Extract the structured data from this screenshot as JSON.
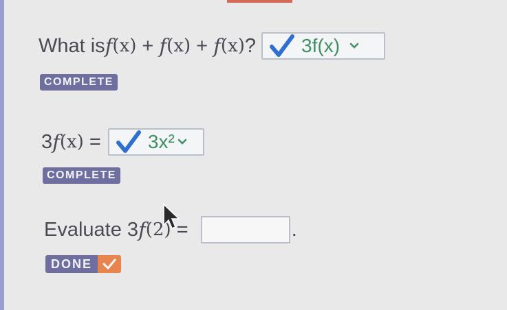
{
  "question1": {
    "prefix": "What is ",
    "f": "f",
    "arg": "(x)",
    "plus": " + ",
    "suffix": "?",
    "answer": "3f(x)"
  },
  "badge1": {
    "label": "COMPLETE"
  },
  "question2": {
    "coef": "3",
    "f": "f",
    "arg": "(x)",
    "equals": " = ",
    "answer": "3x²"
  },
  "badge2": {
    "label": "COMPLETE"
  },
  "question3": {
    "prefix": "Evaluate ",
    "coef": "3",
    "f": "f",
    "arg": "(2)",
    "equals": " = ",
    "input_value": "",
    "period": "."
  },
  "done_button": {
    "label": "DONE"
  },
  "colors": {
    "badge": "#6f6f9f",
    "correct": "#3f8f63",
    "check": "#2f6fd0",
    "done_accent": "#e8844e"
  },
  "icons": {
    "answer_check": "checkmark-icon",
    "dropdown": "chevron-down-icon",
    "done_check": "checkmark-icon",
    "pointer": "mouse-pointer-icon"
  }
}
